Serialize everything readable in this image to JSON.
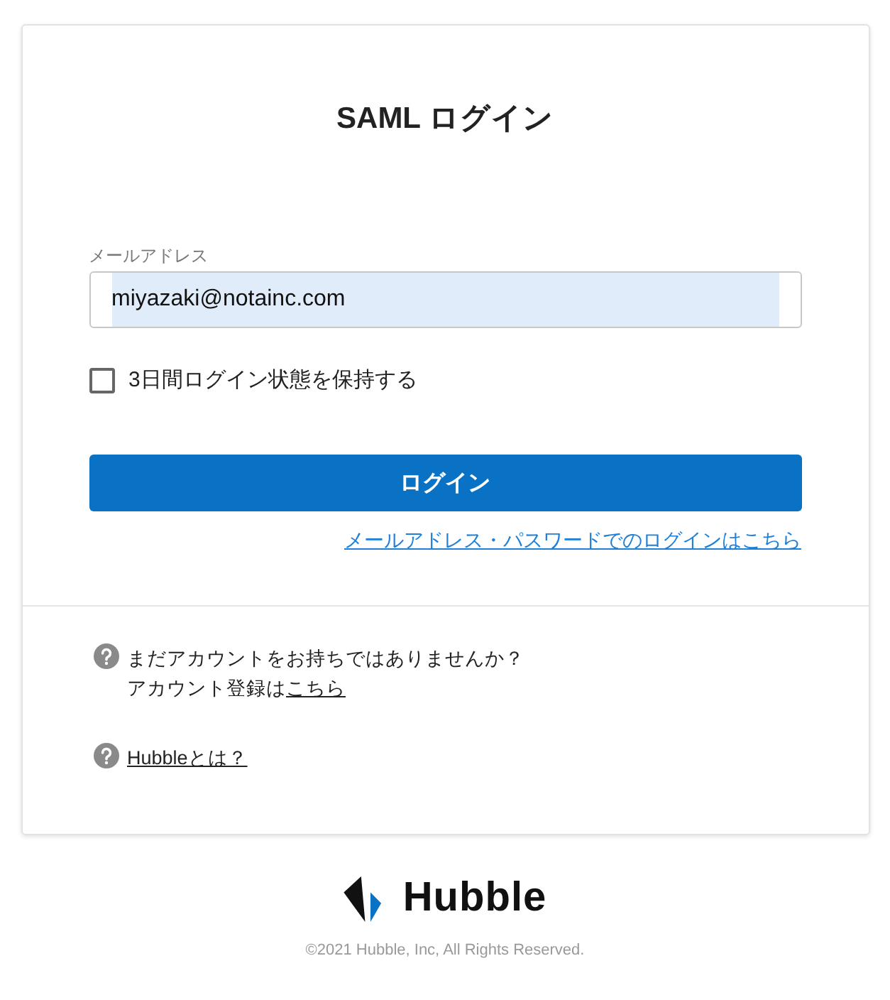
{
  "title": "SAML ログイン",
  "email": {
    "label": "メールアドレス",
    "value": "miyazaki@notainc.com"
  },
  "remember": {
    "label": "3日間ログイン状態を保持する",
    "checked": false
  },
  "login_button": "ログイン",
  "password_login_link": "メールアドレス・パスワードでのログインはこちら",
  "help": [
    {
      "text": "まだアカウントをお持ちではありませんか？",
      "prefix": "アカウント登録は",
      "link": "こちら"
    },
    {
      "link": "Hubbleとは？"
    }
  ],
  "footer": {
    "logo": "Hubble",
    "copyright": "©2021 Hubble, Inc, All Rights Reserved."
  }
}
